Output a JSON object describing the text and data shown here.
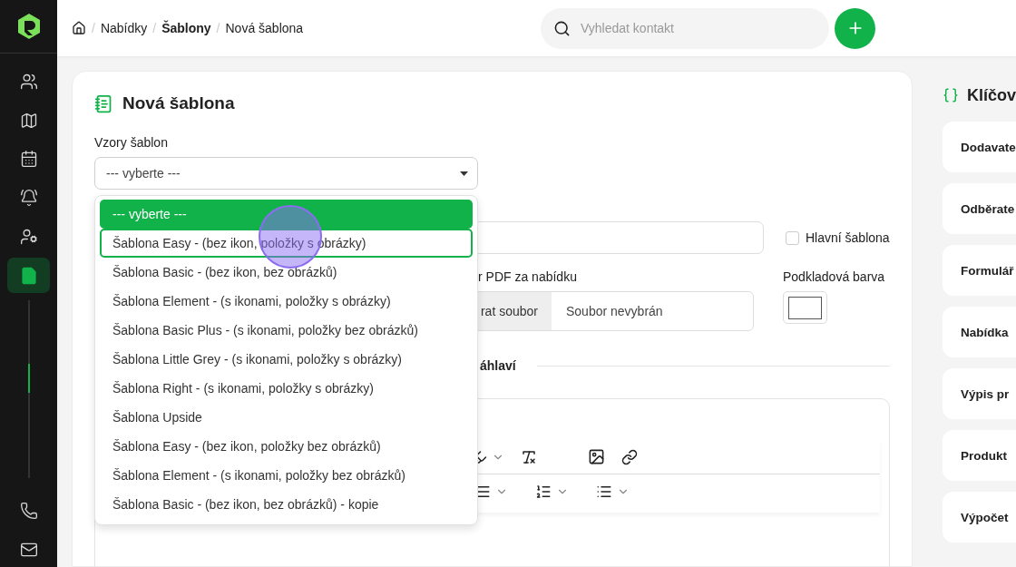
{
  "sidebar": {
    "items": [
      {
        "kind": "users",
        "selected": false
      },
      {
        "kind": "map",
        "selected": false
      },
      {
        "kind": "calendar",
        "selected": false
      },
      {
        "kind": "bell",
        "selected": false
      },
      {
        "kind": "user-key",
        "selected": false
      },
      {
        "kind": "document",
        "selected": true
      },
      {
        "kind": "phone",
        "selected": false
      },
      {
        "kind": "mail",
        "selected": false
      }
    ]
  },
  "breadcrumb": [
    {
      "separator": "/",
      "label": "Nabídky",
      "bold": false
    },
    {
      "separator": "/",
      "label": "Šablony",
      "bold": true
    },
    {
      "separator": "/",
      "label": "Nová šablona",
      "bold": false
    }
  ],
  "search": {
    "placeholder": "Vyhledat kontakt"
  },
  "form": {
    "title": "Nová šablona",
    "template_select": {
      "label": "Vzory šablon",
      "value": "--- vyberte ---",
      "expanded": true,
      "options": [
        {
          "label": "--- vyberte ---",
          "selected": true,
          "focused": false
        },
        {
          "label": "Šablona Easy - (bez ikon, položky s obrázky)",
          "selected": false,
          "focused": true
        },
        {
          "label": "Šablona Basic - (bez ikon, bez obrázků)",
          "selected": false,
          "focused": false
        },
        {
          "label": "Šablona Element - (s ikonami, položky s obrázky)",
          "selected": false,
          "focused": false
        },
        {
          "label": "Šablona Basic Plus - (s ikonami, položky bez obrázků)",
          "selected": false,
          "focused": false
        },
        {
          "label": "Šablona Little Grey - (s ikonami, položky s obrázky)",
          "selected": false,
          "focused": false
        },
        {
          "label": "Šablona Right - (s ikonami, položky s obrázky)",
          "selected": false,
          "focused": false
        },
        {
          "label": "Šablona Upside",
          "selected": false,
          "focused": false
        },
        {
          "label": "Šablona Easy - (bez ikon, položky bez obrázků)",
          "selected": false,
          "focused": false
        },
        {
          "label": "Šablona Element - (s ikonami, položky bez obrázků)",
          "selected": false,
          "focused": false
        },
        {
          "label": "Šablona Basic - (bez ikon, bez obrázků) - kopie",
          "selected": false,
          "focused": false
        }
      ]
    },
    "main_template": {
      "label": "Hlavní šablona",
      "checked": false
    },
    "pdf_label": "r PDF za nabídku",
    "file_button": "rat soubor",
    "file_status": "Soubor nevybrán",
    "background_color_label": "Podkladová barva",
    "section_title": "áhlaví"
  },
  "keywords": {
    "title": "Klíčov",
    "items": [
      "Dodavate",
      "Odběrate",
      "Formulář",
      "Nabídka",
      "Výpis pr",
      "Produkt",
      "Výpočet"
    ]
  },
  "click_marker": true
}
